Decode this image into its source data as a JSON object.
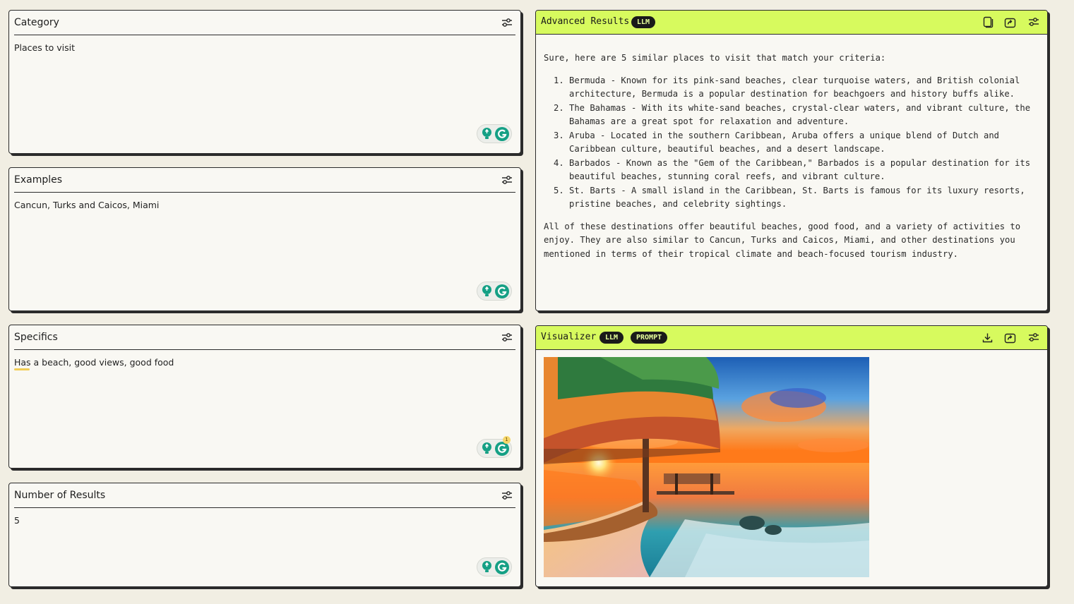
{
  "inputs": [
    {
      "title": "Category",
      "value": "Places to visit"
    },
    {
      "title": "Examples",
      "value": "Cancun, Turks and Caicos, Miami"
    },
    {
      "title": "Specifics",
      "value": "Has a beach, good views, good food",
      "grammar_count": "1"
    },
    {
      "title": "Number of Results",
      "value": "5"
    }
  ],
  "results_panel": {
    "title": "Advanced Results",
    "badge": "LLM",
    "intro": "Sure, here are 5 similar places to visit that match your criteria:",
    "items": [
      "Bermuda - Known for its pink-sand beaches, clear turquoise waters, and British colonial architecture, Bermuda is a popular destination for beachgoers and history buffs alike.",
      "The Bahamas - With its white-sand beaches, crystal-clear waters, and vibrant culture, the Bahamas are a great spot for relaxation and adventure.",
      "Aruba - Located in the southern Caribbean, Aruba offers a unique blend of Dutch and Caribbean culture, beautiful beaches, and a desert landscape.",
      "Barbados - Known as the \"Gem of the Caribbean,\" Barbados is a popular destination for its beautiful beaches, stunning coral reefs, and vibrant culture.",
      "St. Barts - A small island in the Caribbean, St. Barts is famous for its luxury resorts, pristine beaches, and celebrity sightings."
    ],
    "outro": "All of these destinations offer beautiful beaches, good food, and a variety of activities to enjoy. They are also similar to Cancun, Turks and Caicos, Miami, and other destinations you mentioned in terms of their tropical climate and beach-focused tourism industry."
  },
  "visualizer_panel": {
    "title": "Visualizer",
    "badges": [
      "LLM",
      "PROMPT"
    ]
  },
  "colors": {
    "accent": "#d7fa5e",
    "background": "#f1eee3",
    "card": "#f9f8f3",
    "border": "#2b2b2b",
    "grammarly": "#15a085"
  },
  "icons": {
    "tune": "sliders-icon",
    "copy": "copy-icon",
    "share": "share-icon",
    "download": "download-icon",
    "grammarly": "grammarly-icon",
    "bulb": "lightbulb-icon"
  }
}
